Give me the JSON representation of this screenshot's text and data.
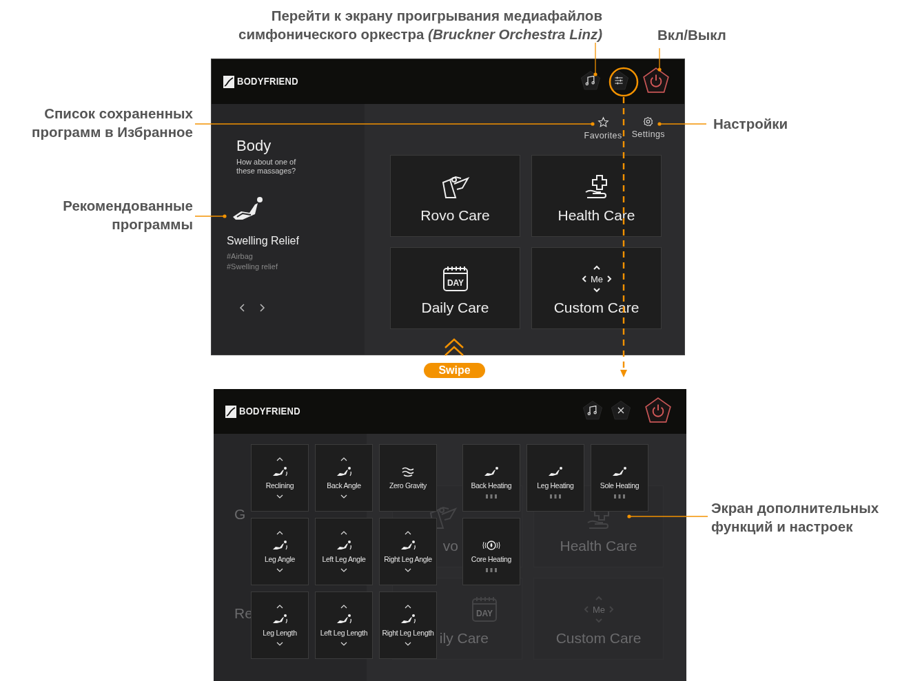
{
  "callouts": [
    {
      "kind": "media",
      "text": "Перейти к экрану проигрывания медиафайлов симфонического оркестра *(Bruckner Orchestra Linz)*"
    },
    {
      "kind": "power",
      "text": "Вкл/Выкл"
    },
    {
      "kind": "favorites",
      "text": "Список сохраненных программ в Избранное"
    },
    {
      "kind": "settings",
      "text": "Настройки"
    },
    {
      "kind": "recommended",
      "text": "Рекомендованные программы"
    },
    {
      "kind": "functions",
      "text": "Экран дополнительных функций и настроек"
    }
  ],
  "home_screen": {
    "brand": "BODYFRIEND",
    "header_buttons": [
      {
        "kind": "music"
      },
      {
        "kind": "sliders"
      },
      {
        "kind": "power"
      }
    ],
    "quick_links": [
      {
        "kind": "favorites",
        "label": "Favorites"
      },
      {
        "kind": "settings",
        "label": "Settings"
      }
    ],
    "recommend": {
      "title": "Body",
      "subtitle": "How about one of these massages?",
      "program": "Swelling Relief",
      "tags": [
        "#Airbag",
        "#Swelling relief"
      ]
    },
    "tiles": [
      {
        "kind": "rovo",
        "label": "Rovo Care"
      },
      {
        "kind": "health",
        "label": "Health Care"
      },
      {
        "kind": "daily",
        "label": "Daily Care",
        "icon_text": "DAY"
      },
      {
        "kind": "custom",
        "label": "Custom Care",
        "icon_text": "Me"
      }
    ]
  },
  "swipe_label": "Swipe",
  "function_screen": {
    "brand": "BODYFRIEND",
    "header_buttons": [
      {
        "kind": "music"
      },
      {
        "kind": "close"
      },
      {
        "kind": "power"
      }
    ],
    "background": {
      "left": [
        "G",
        "Re"
      ],
      "tiles": [
        {
          "kind": "rovo",
          "label": "vo"
        },
        {
          "kind": "health",
          "label": "Health Care"
        },
        {
          "kind": "daily",
          "label": "ily Care",
          "icon_text": "DAY"
        },
        {
          "kind": "custom",
          "label": "Custom Care",
          "icon_text": "Me"
        }
      ]
    },
    "position_tiles": [
      {
        "kind": "adjust",
        "label": "Reclining"
      },
      {
        "kind": "adjust",
        "label": "Back Angle"
      },
      {
        "kind": "static",
        "label": "Zero Gravity"
      },
      {
        "kind": "adjust",
        "label": "Leg Angle"
      },
      {
        "kind": "adjust",
        "label": "Left Leg Angle"
      },
      {
        "kind": "adjust",
        "label": "Right Leg Angle"
      },
      {
        "kind": "adjust",
        "label": "Leg Length"
      },
      {
        "kind": "adjust",
        "label": "Left Leg Length"
      },
      {
        "kind": "adjust",
        "label": "Right Leg Length"
      }
    ],
    "heating_tiles": [
      {
        "kind": "heating",
        "label": "Back Heating"
      },
      {
        "kind": "heating",
        "label": "Leg Heating"
      },
      {
        "kind": "heating",
        "label": "Sole Heating"
      },
      {
        "kind": "core",
        "label": "Core Heating"
      }
    ]
  }
}
